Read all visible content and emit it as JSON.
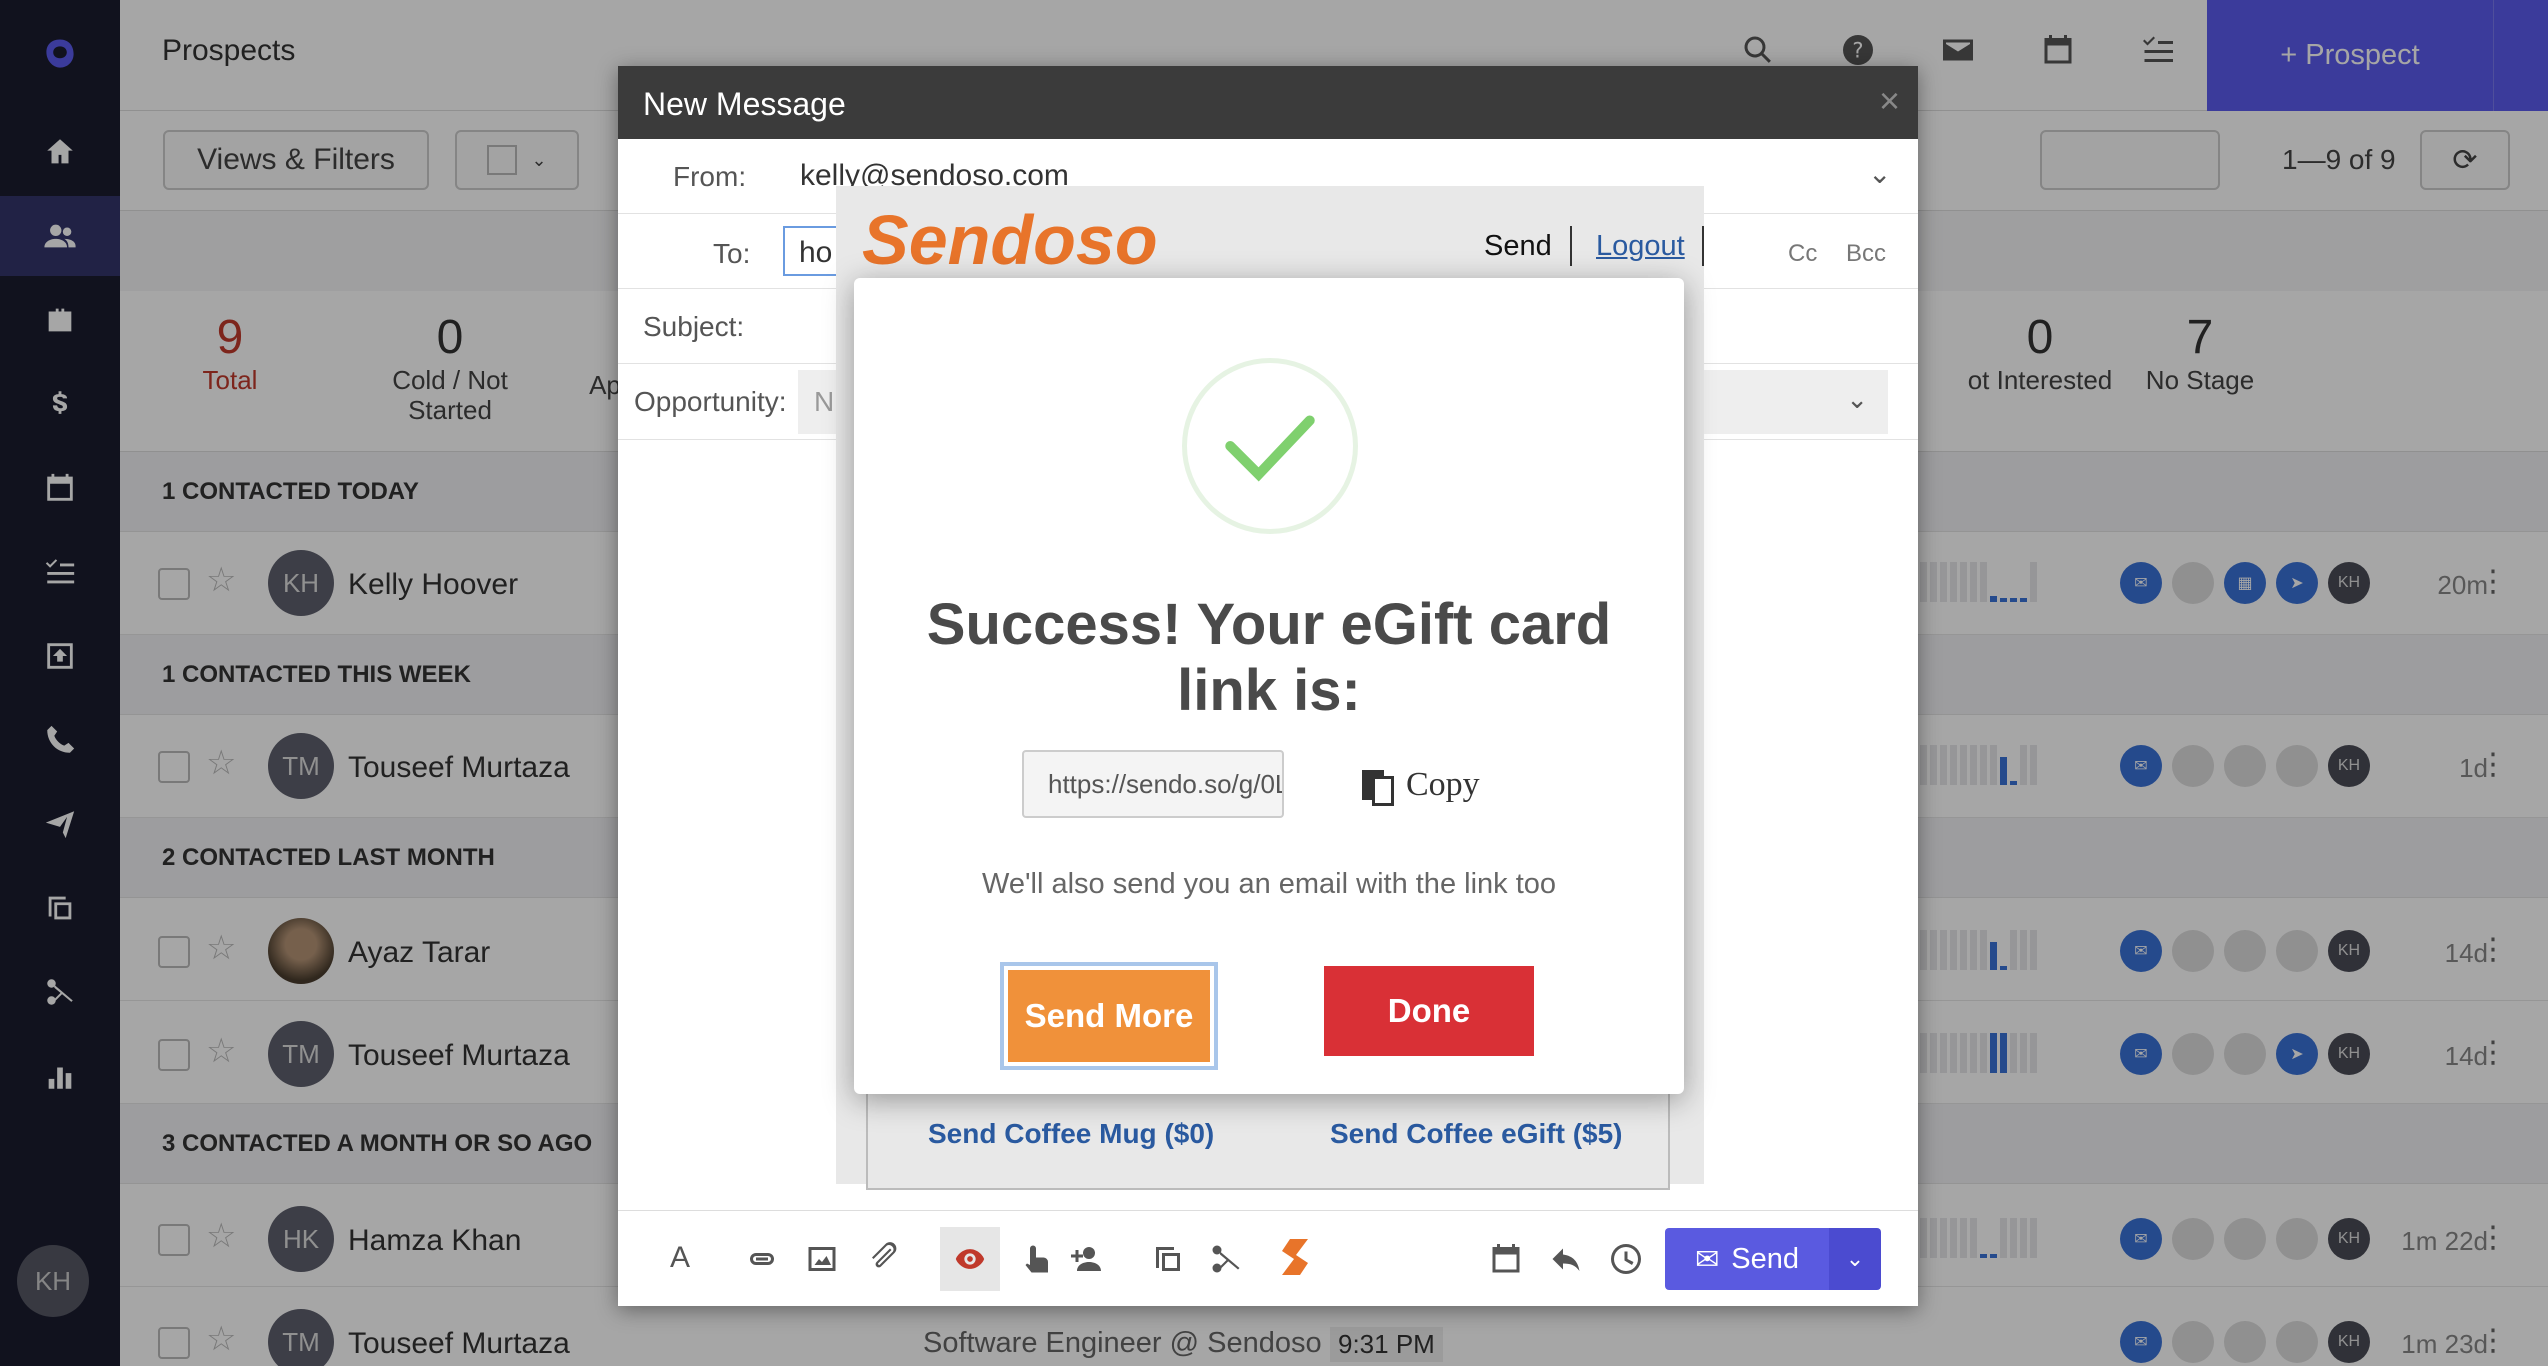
{
  "header": {
    "title": "Prospects",
    "prospect_button": "+ Prospect"
  },
  "toolbar": {
    "views_filters": "Views & Filters",
    "pagination": "1—9 of 9"
  },
  "stats": [
    {
      "count": "9",
      "label": "Total"
    },
    {
      "count": "0",
      "label": "Cold / Not Started"
    },
    {
      "count": "0",
      "label": "ot Interested"
    },
    {
      "count": "7",
      "label": "No Stage"
    }
  ],
  "stat_partial_label": "Ap",
  "groups": [
    "1 CONTACTED TODAY",
    "1 CONTACTED THIS WEEK",
    "2 CONTACTED LAST MONTH",
    "3 CONTACTED A MONTH OR SO AGO"
  ],
  "rows": [
    {
      "initials": "KH",
      "name": "Kelly Hoover",
      "age": "20m"
    },
    {
      "initials": "TM",
      "name": "Touseef Murtaza",
      "age": "1d"
    },
    {
      "initials": "",
      "name": "Ayaz Tarar",
      "age": "14d"
    },
    {
      "initials": "TM",
      "name": "Touseef Murtaza",
      "age": "14d"
    },
    {
      "initials": "HK",
      "name": "Hamza Khan",
      "age": "1m 22d"
    },
    {
      "initials": "TM",
      "name": "Touseef Murtaza",
      "age": "1m 23d",
      "title": "Software Engineer @ Sendoso",
      "time": "9:31 PM"
    }
  ],
  "chip_kh": "KH",
  "nav_avatar": "KH",
  "message": {
    "title": "New Message",
    "close": "×",
    "from_label": "From:",
    "from_value": "kelly@sendoso.com",
    "to_label": "To:",
    "to_value": "ho",
    "cc": "Cc",
    "bcc": "Bcc",
    "subject_label": "Subject:",
    "opportunity_label": "Opportunity:",
    "opportunity_value": "N",
    "send_label": "Send"
  },
  "sendoso": {
    "logo": "Sendoso",
    "send_link": "Send",
    "logout_link": "Logout",
    "gift_left": "Send Coffee Mug ($0)",
    "gift_right": "Send Coffee eGift ($5)"
  },
  "success": {
    "title": "Success! Your eGift card link is:",
    "link": "https://sendo.so/g/0L",
    "copy": "Copy",
    "note": "We'll also send you an email with the link too",
    "send_more": "Send More",
    "done": "Done"
  }
}
